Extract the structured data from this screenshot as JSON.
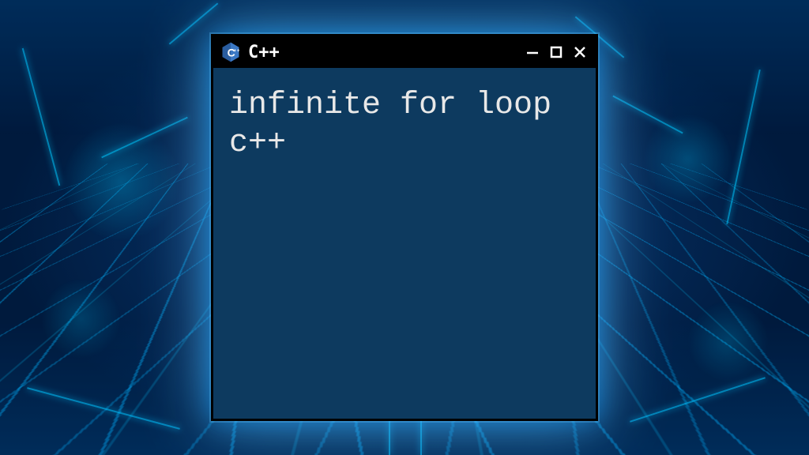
{
  "window": {
    "title": "C++",
    "icon_name": "cpp-logo-icon",
    "content_text": "infinite for loop c++"
  },
  "colors": {
    "window_bg": "#0d3a5f",
    "titlebar_bg": "#000000",
    "text": "#e8e8e8",
    "glow": "#00c8ff"
  }
}
